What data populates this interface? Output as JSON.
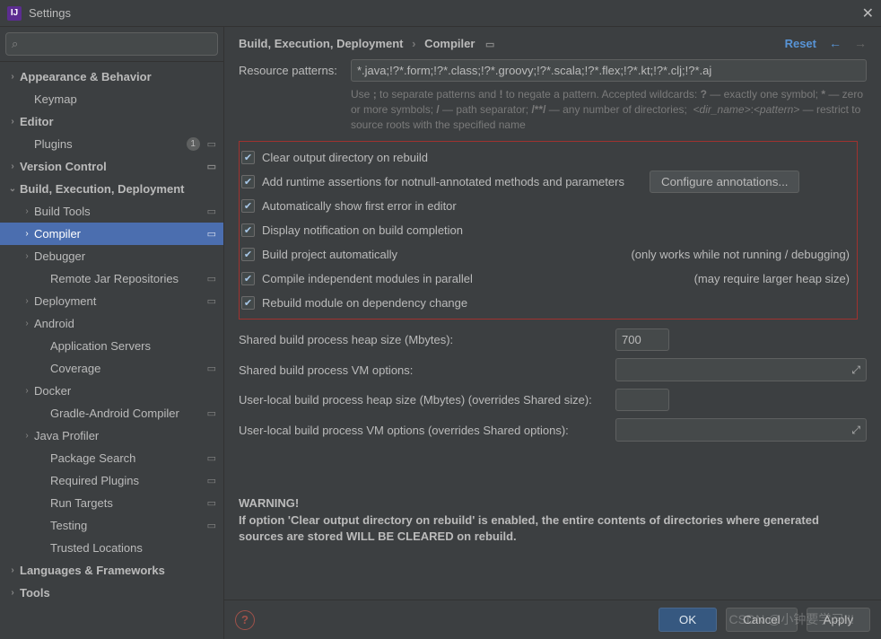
{
  "window": {
    "title": "Settings"
  },
  "search": {
    "placeholder": ""
  },
  "sidebar": {
    "items": [
      {
        "label": "Appearance & Behavior",
        "level": 0,
        "chev": "›",
        "scope": false
      },
      {
        "label": "Keymap",
        "level": 1,
        "chev": "",
        "scope": false
      },
      {
        "label": "Editor",
        "level": 0,
        "chev": "›",
        "scope": false
      },
      {
        "label": "Plugins",
        "level": 1,
        "chev": "",
        "badge": "1",
        "scope": true
      },
      {
        "label": "Version Control",
        "level": 0,
        "chev": "›",
        "scope": true
      },
      {
        "label": "Build, Execution, Deployment",
        "level": 0,
        "chev": "⌄",
        "scope": false
      },
      {
        "label": "Build Tools",
        "level": 1,
        "chev": "›",
        "scope": true
      },
      {
        "label": "Compiler",
        "level": 1,
        "chev": "›",
        "scope": true,
        "selected": true
      },
      {
        "label": "Debugger",
        "level": 1,
        "chev": "›",
        "scope": false
      },
      {
        "label": "Remote Jar Repositories",
        "level": 2,
        "chev": "",
        "scope": true
      },
      {
        "label": "Deployment",
        "level": 1,
        "chev": "›",
        "scope": true
      },
      {
        "label": "Android",
        "level": 1,
        "chev": "›",
        "scope": false
      },
      {
        "label": "Application Servers",
        "level": 2,
        "chev": "",
        "scope": false
      },
      {
        "label": "Coverage",
        "level": 2,
        "chev": "",
        "scope": true
      },
      {
        "label": "Docker",
        "level": 1,
        "chev": "›",
        "scope": false
      },
      {
        "label": "Gradle-Android Compiler",
        "level": 2,
        "chev": "",
        "scope": true
      },
      {
        "label": "Java Profiler",
        "level": 1,
        "chev": "›",
        "scope": false
      },
      {
        "label": "Package Search",
        "level": 2,
        "chev": "",
        "scope": true
      },
      {
        "label": "Required Plugins",
        "level": 2,
        "chev": "",
        "scope": true
      },
      {
        "label": "Run Targets",
        "level": 2,
        "chev": "",
        "scope": true
      },
      {
        "label": "Testing",
        "level": 2,
        "chev": "",
        "scope": true
      },
      {
        "label": "Trusted Locations",
        "level": 2,
        "chev": "",
        "scope": false
      },
      {
        "label": "Languages & Frameworks",
        "level": 0,
        "chev": "›",
        "scope": false
      },
      {
        "label": "Tools",
        "level": 0,
        "chev": "›",
        "scope": false
      }
    ]
  },
  "breadcrumb": {
    "root": "Build, Execution, Deployment",
    "leaf": "Compiler"
  },
  "actions": {
    "reset": "Reset"
  },
  "resource": {
    "label": "Resource patterns:",
    "value": "*.java;!?*.form;!?*.class;!?*.groovy;!?*.scala;!?*.flex;!?*.kt;!?*.clj;!?*.aj",
    "hint": "Use ; to separate patterns and ! to negate a pattern. Accepted wildcards: ? — exactly one symbol; * — zero or more symbols; / — path separator; /**/ — any number of directories;  <dir_name>:<pattern> — restrict to source roots with the specified name"
  },
  "checks": [
    {
      "label": "Clear output directory on rebuild",
      "checked": true
    },
    {
      "label": "Add runtime assertions for notnull-annotated methods and parameters",
      "checked": true,
      "button": "Configure annotations..."
    },
    {
      "label": "Automatically show first error in editor",
      "checked": true
    },
    {
      "label": "Display notification on build completion",
      "checked": true
    },
    {
      "label": "Build project automatically",
      "checked": true,
      "note": "(only works while not running / debugging)"
    },
    {
      "label": "Compile independent modules in parallel",
      "checked": true,
      "note": "(may require larger heap size)"
    },
    {
      "label": "Rebuild module on dependency change",
      "checked": true
    }
  ],
  "fields": {
    "heap": {
      "label": "Shared build process heap size (Mbytes):",
      "value": "700"
    },
    "vm": {
      "label": "Shared build process VM options:",
      "value": ""
    },
    "uheap": {
      "label": "User-local build process heap size (Mbytes) (overrides Shared size):",
      "value": ""
    },
    "uvm": {
      "label": "User-local build process VM options (overrides Shared options):",
      "value": ""
    }
  },
  "warning": {
    "title": "WARNING!",
    "body": "If option 'Clear output directory on rebuild' is enabled, the entire contents of directories where generated sources are stored WILL BE CLEARED on rebuild."
  },
  "buttons": {
    "ok": "OK",
    "cancel": "Cancel",
    "apply": "Apply"
  },
  "watermark": "CSDN @小钟要学习!!!"
}
